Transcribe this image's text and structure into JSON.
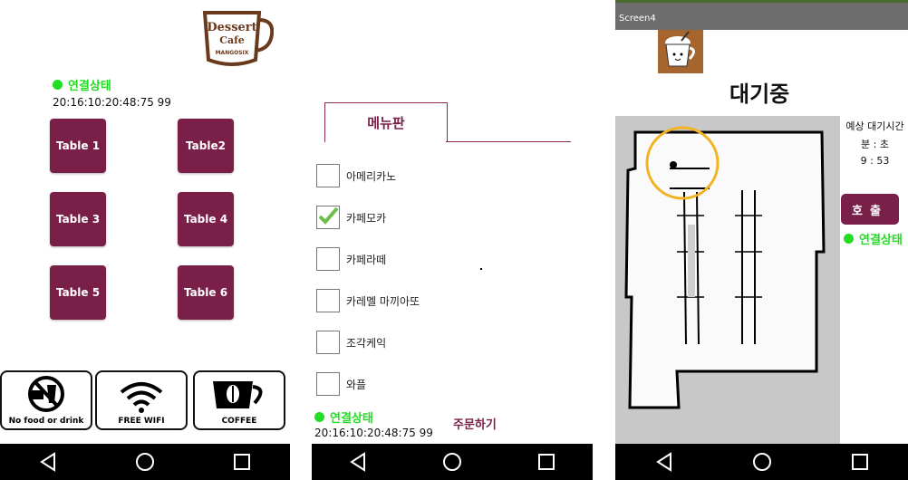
{
  "panel1": {
    "logo": {
      "line1": "Dessert",
      "line2": "Cafe",
      "line3": "MANGOSIX"
    },
    "status": "연결상태",
    "device_id": "20:16:10:20:48:75 99",
    "tables": [
      "Table 1",
      "Table2",
      "Table 3",
      "Table 4",
      "Table 5",
      "Table 6"
    ],
    "icons": [
      {
        "caption": "No food or drink",
        "icon": "no-food-icon"
      },
      {
        "caption": "FREE WIFI",
        "icon": "wifi-icon"
      },
      {
        "caption": "COFFEE",
        "icon": "coffee-cup-icon"
      }
    ]
  },
  "panel2": {
    "tab": "메뉴판",
    "menu": [
      {
        "label": "아메리카노",
        "checked": false
      },
      {
        "label": "카페모카",
        "checked": true
      },
      {
        "label": "카페라떼",
        "checked": false
      },
      {
        "label": "카레멜 마끼아또",
        "checked": false
      },
      {
        "label": "조각케익",
        "checked": false
      },
      {
        "label": "와플",
        "checked": false
      }
    ],
    "status": "연결상태",
    "device_id": "20:16:10:20:48:75 99",
    "order": "주문하기"
  },
  "panel3": {
    "screen_title": "Screen4",
    "waiting": "대기중",
    "eta_label": "예상 대기시간",
    "eta_units": "분 : 초",
    "eta_value": "9 : 53",
    "call": "호출",
    "status": "연결상태"
  },
  "colors": {
    "accent": "#7a2048",
    "status": "#22dd22",
    "navbar": "#000000"
  }
}
